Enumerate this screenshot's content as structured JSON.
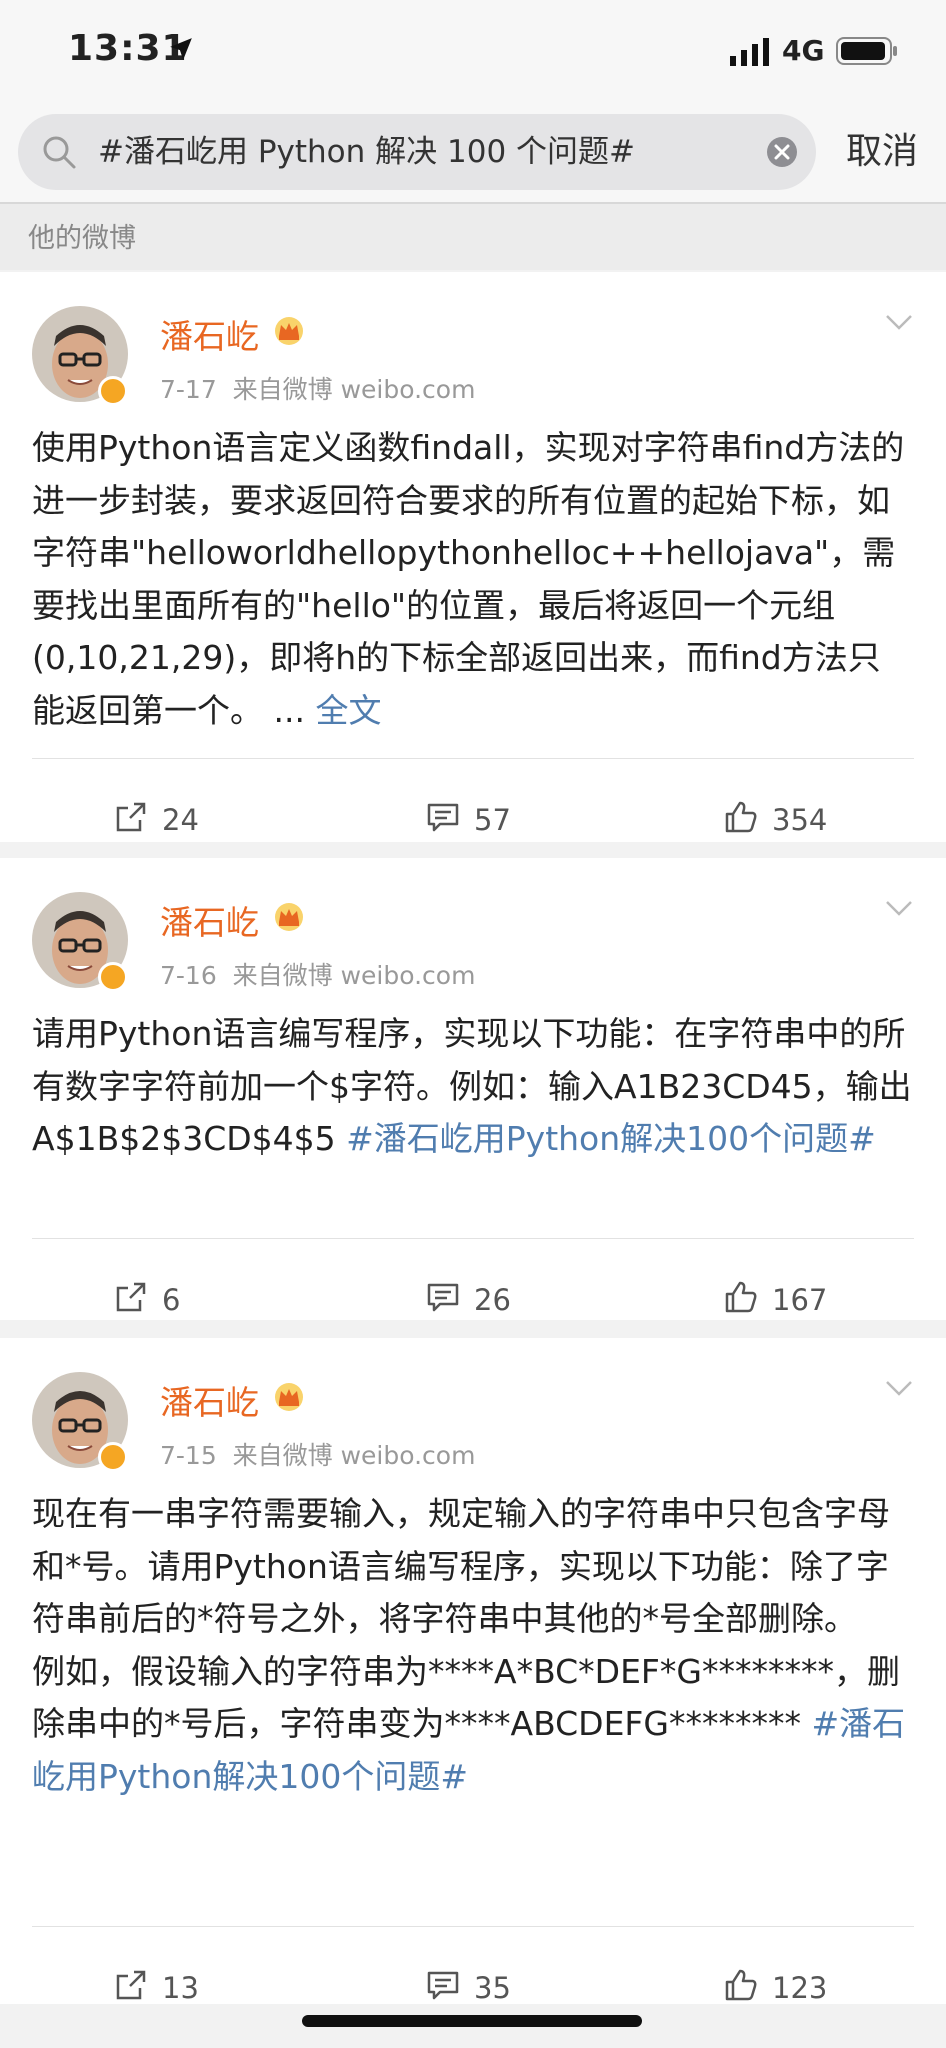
{
  "status_bar": {
    "time": "13:31",
    "network": "4G"
  },
  "search": {
    "query": "#潘石屹用 Python 解决 100 个问题#",
    "cancel_label": "取消"
  },
  "section_label": "他的微博",
  "posts": [
    {
      "author": "潘石屹",
      "date": "7-17",
      "source": "来自微博 weibo.com",
      "body_text": "使用Python语言定义函数findall，实现对字符串find方法的进一步封装，要求返回符合要求的所有位置的起始下标，如字符串\"helloworldhellopythonhelloc++hellojava\"，需要找出里面所有的\"hello\"的位置，最后将返回一个元组(0,10,21,29)，即将h的下标全部返回出来，而find方法只能返回第一个。 ... ",
      "body_link": "全文",
      "reposts": "24",
      "comments": "57",
      "likes": "354"
    },
    {
      "author": "潘石屹",
      "date": "7-16",
      "source": "来自微博 weibo.com",
      "body_text": "请用Python语言编写程序，实现以下功能：在字符串中的所有数字字符前加一个$字符。例如：输入A1B23CD45，输出A$1B$2$3CD$4$5 ",
      "body_link": "#潘石屹用Python解决100个问题#",
      "reposts": "6",
      "comments": "26",
      "likes": "167"
    },
    {
      "author": "潘石屹",
      "date": "7-15",
      "source": "来自微博 weibo.com",
      "body_text": "现在有一串字符需要输入，规定输入的字符串中只包含字母和*号。请用Python语言编写程序，实现以下功能：除了字符串前后的*符号之外，将字符串中其他的*号全部删除。\n例如，假设输入的字符串为****A*BC*DEF*G********，删除串中的*号后，字符串变为****ABCDEFG******** ",
      "body_link": "#潘石屹用Python解决100个问题#",
      "reposts": "13",
      "comments": "35",
      "likes": "123"
    }
  ],
  "colors": {
    "author": "#e86722",
    "link": "#507daf",
    "badge": "#f5a623"
  }
}
